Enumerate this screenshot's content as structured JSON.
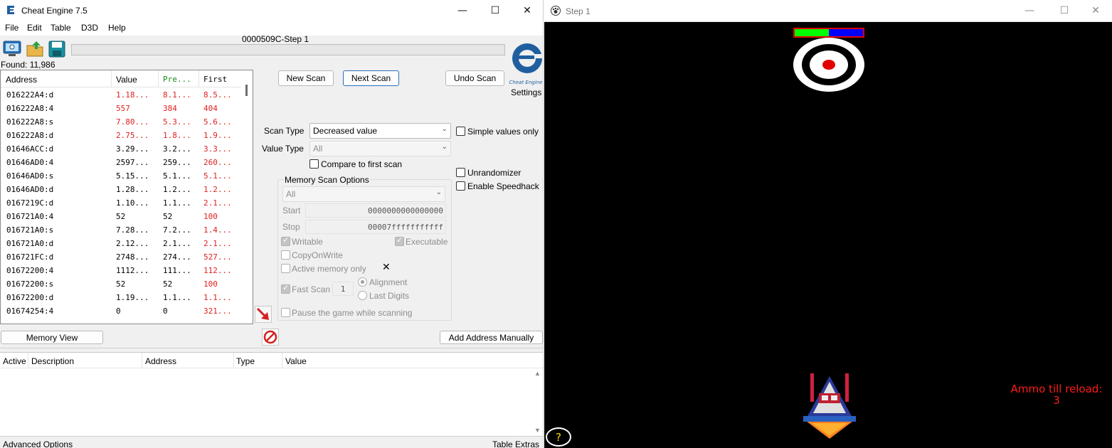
{
  "ce": {
    "title": "Cheat Engine 7.5",
    "menu": [
      "File",
      "Edit",
      "Table",
      "D3D",
      "Help"
    ],
    "process_title": "0000509C-Step 1",
    "found": "Found: 11,986",
    "settings": "Settings",
    "columns": {
      "address": "Address",
      "value": "Value",
      "previous": "Pre...",
      "first": "First"
    },
    "results": [
      {
        "addr": "016222A4:d",
        "value": "1.18...",
        "prev": "8.1...",
        "first": "8.5...",
        "changed": true
      },
      {
        "addr": "016222A8:4",
        "value": "557",
        "prev": "384",
        "first": "404",
        "changed": true
      },
      {
        "addr": "016222A8:s",
        "value": "7.80...",
        "prev": "5.3...",
        "first": "5.6...",
        "changed": true
      },
      {
        "addr": "016222A8:d",
        "value": "2.75...",
        "prev": "1.8...",
        "first": "1.9...",
        "changed": true
      },
      {
        "addr": "01646ACC:d",
        "value": "3.29...",
        "prev": "3.2...",
        "first": "3.3...",
        "changed": false
      },
      {
        "addr": "01646AD0:4",
        "value": "2597...",
        "prev": "259...",
        "first": "260...",
        "changed": false
      },
      {
        "addr": "01646AD0:s",
        "value": "5.15...",
        "prev": "5.1...",
        "first": "5.1...",
        "changed": false
      },
      {
        "addr": "01646AD0:d",
        "value": "1.28...",
        "prev": "1.2...",
        "first": "1.2...",
        "changed": false
      },
      {
        "addr": "0167219C:d",
        "value": "1.10...",
        "prev": "1.1...",
        "first": "2.1...",
        "changed": false
      },
      {
        "addr": "016721A0:4",
        "value": "52",
        "prev": "52",
        "first": "100",
        "changed": false
      },
      {
        "addr": "016721A0:s",
        "value": "7.28...",
        "prev": "7.2...",
        "first": "1.4...",
        "changed": false
      },
      {
        "addr": "016721A0:d",
        "value": "2.12...",
        "prev": "2.1...",
        "first": "2.1...",
        "changed": false
      },
      {
        "addr": "016721FC:d",
        "value": "2748...",
        "prev": "274...",
        "first": "527...",
        "changed": false
      },
      {
        "addr": "01672200:4",
        "value": "1112...",
        "prev": "111...",
        "first": "112...",
        "changed": false
      },
      {
        "addr": "01672200:s",
        "value": "52",
        "prev": "52",
        "first": "100",
        "changed": false
      },
      {
        "addr": "01672200:d",
        "value": "1.19...",
        "prev": "1.1...",
        "first": "1.1...",
        "changed": false
      },
      {
        "addr": "01674254:4",
        "value": "0",
        "prev": "0",
        "first": "321...",
        "changed": false
      }
    ],
    "buttons": {
      "new_scan": "New Scan",
      "next_scan": "Next Scan",
      "undo_scan": "Undo Scan",
      "memory_view": "Memory View",
      "add_address": "Add Address Manually"
    },
    "scan_type_label": "Scan Type",
    "scan_type_value": "Decreased value",
    "value_type_label": "Value Type",
    "value_type_value": "All",
    "compare_first": "Compare to first scan",
    "simple_values": "Simple values only",
    "unrandomizer": "Unrandomizer",
    "speedhack": "Enable Speedhack",
    "mso_title": "Memory Scan Options",
    "mso_region": "All",
    "start_label": "Start",
    "start_value": "0000000000000000",
    "stop_label": "Stop",
    "stop_value": "00007fffffffffff",
    "writable": "Writable",
    "executable": "Executable",
    "copyonwrite": "CopyOnWrite",
    "active_memory": "Active memory only",
    "fast_scan": "Fast Scan",
    "fast_scan_value": "1",
    "alignment": "Alignment",
    "last_digits": "Last Digits",
    "pause_game": "Pause the game while scanning",
    "table_columns": {
      "active": "Active",
      "description": "Description",
      "address": "Address",
      "type": "Type",
      "value": "Value"
    },
    "advanced_options": "Advanced Options",
    "table_extras": "Table Extras",
    "colors": {
      "changed": "#e02020",
      "normal": "#000000",
      "prev_header": "#1a8a1a"
    }
  },
  "game": {
    "title": "Step 1",
    "ammo_label": "Ammo till reload:",
    "ammo_count": "3",
    "help": "?",
    "target_health": 0.5
  }
}
